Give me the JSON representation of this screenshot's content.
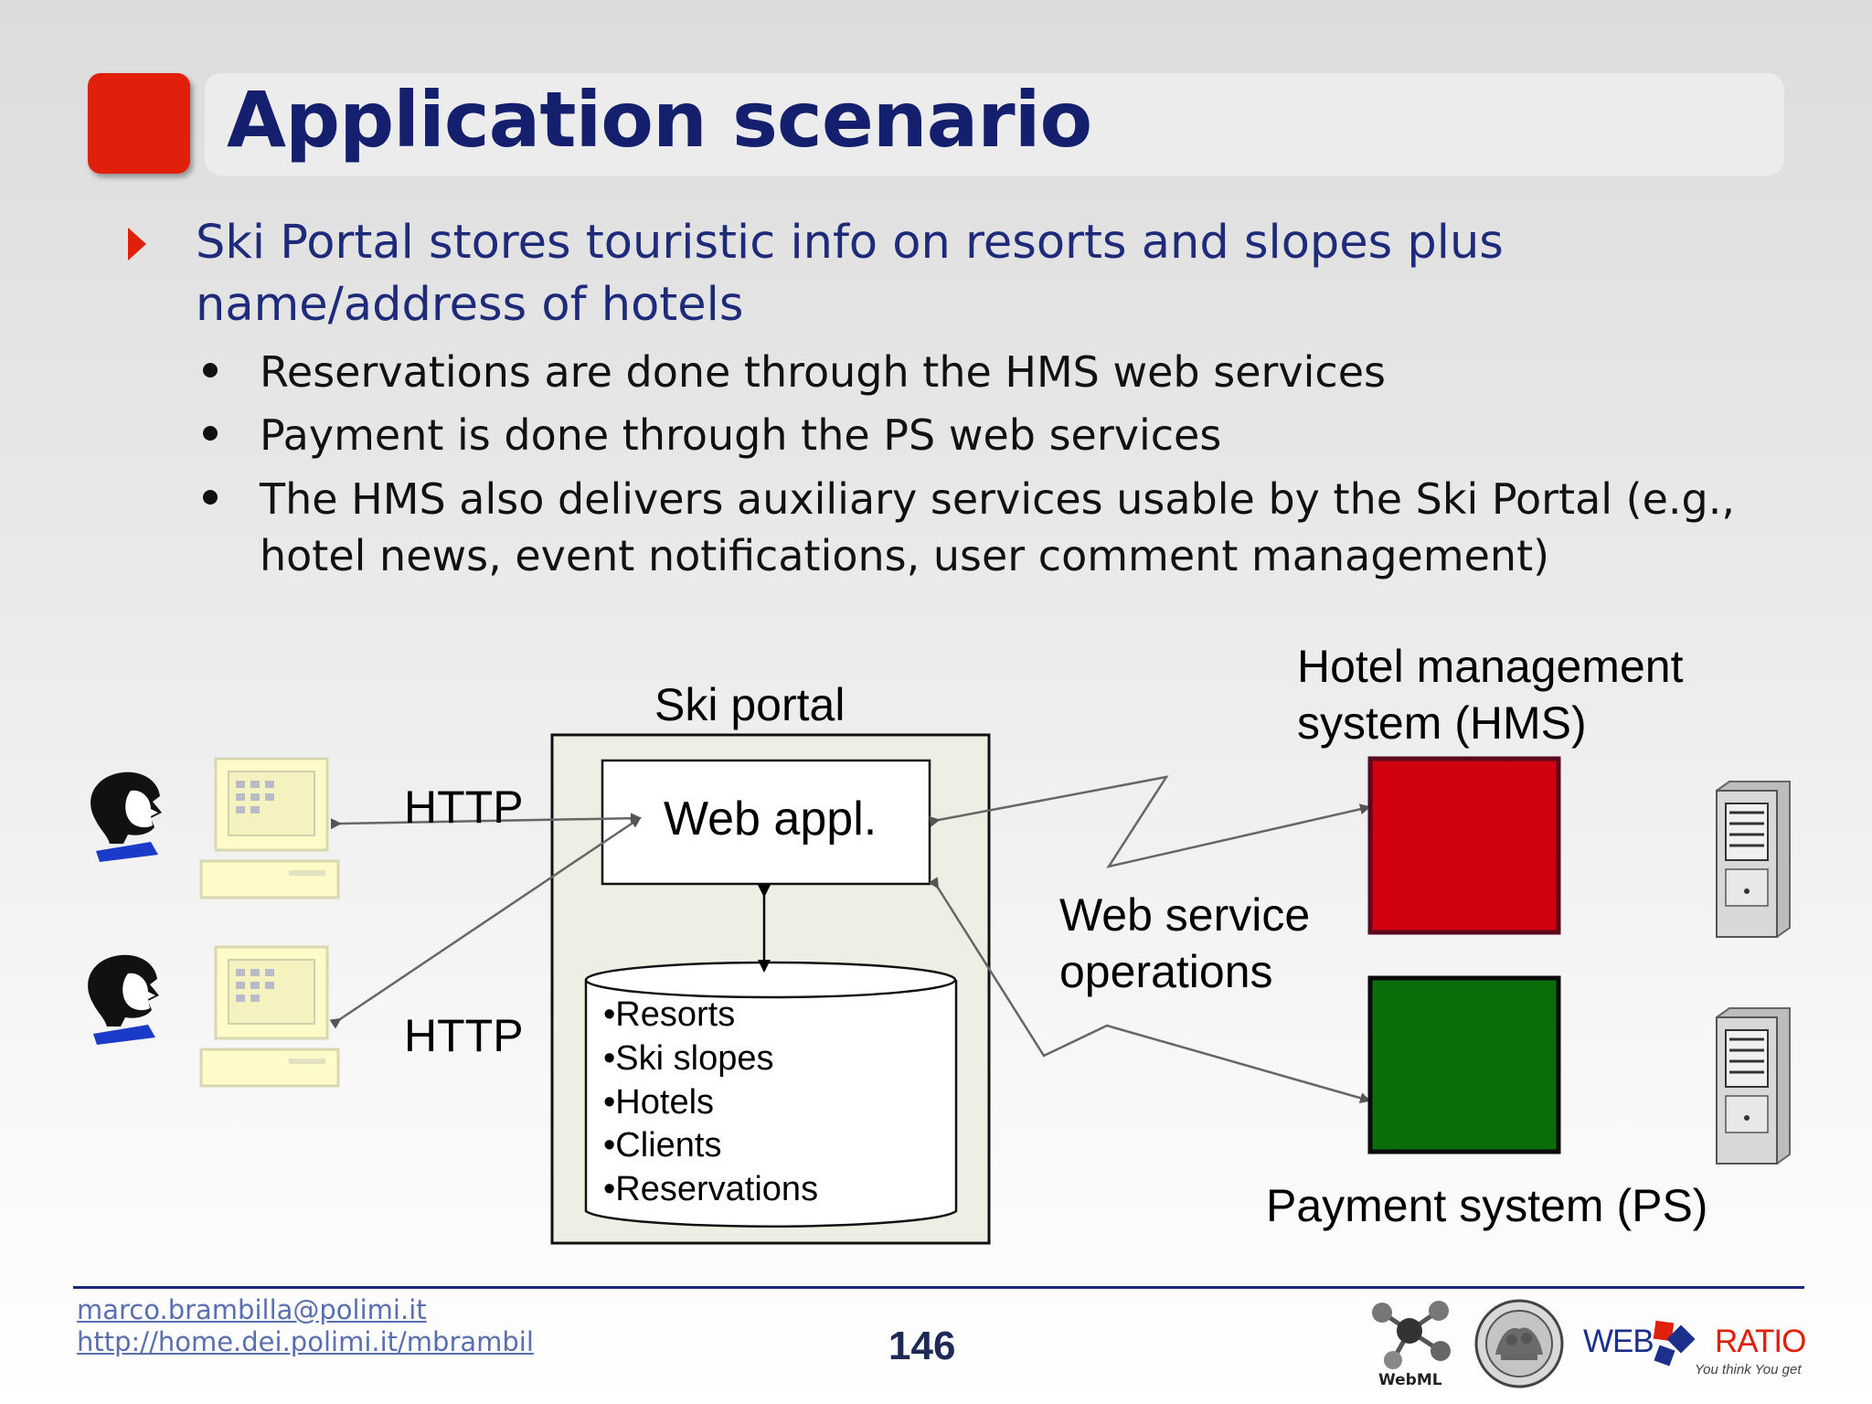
{
  "slide": {
    "title": "Application scenario",
    "bullet_main": {
      "line1": "Ski Portal stores touristic info on resorts and slopes plus",
      "line2": "name/address of hotels"
    },
    "sub_bullets": [
      {
        "line1": "Reservations are done through the HMS web services"
      },
      {
        "line1": "Payment is done through the PS web services"
      },
      {
        "line1": "The HMS also delivers auxiliary services usable by the Ski Portal (e.g.,",
        "line2": "hotel news, event notifications, user comment management)"
      }
    ]
  },
  "diagram": {
    "ski_portal_label": "Ski portal",
    "web_app_label": "Web appl.",
    "database_items": [
      "•Resorts",
      "•Ski slopes",
      "•Hotels",
      "•Clients",
      "•Reservations"
    ],
    "http_top": "HTTP",
    "http_bottom": "HTTP",
    "hms_label_line1": "Hotel management",
    "hms_label_line2": "system (HMS)",
    "ws_label_line1": "Web service",
    "ws_label_line2": "operations",
    "ps_label": "Payment system (PS)",
    "colors": {
      "hms": "#d00010",
      "ps": "#0a6e0a",
      "portal_bg": "#eeeee4",
      "terminal": "#fffbc8"
    }
  },
  "footer": {
    "email": "marco.brambilla@polimi.it",
    "url": "http://home.dei.polimi.it/mbrambil",
    "page_number": "146",
    "webml_logo_text": "WebML",
    "webratio_text_web": "WEB",
    "webratio_text_ratio": "RATIO",
    "webratio_tagline": "You think You get"
  }
}
